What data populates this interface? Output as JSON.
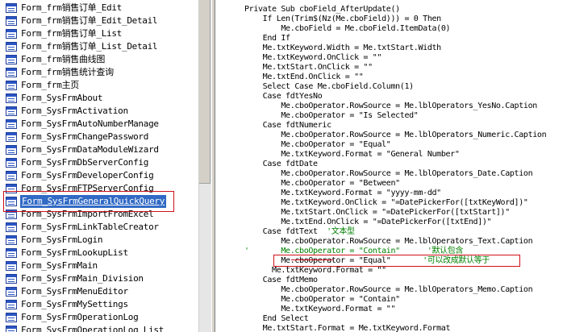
{
  "object_list": {
    "selected_index": 15,
    "items": [
      "Form_frm销售订单_Edit",
      "Form_frm销售订单_Edit_Detail",
      "Form_frm销售订单_List",
      "Form_frm销售订单_List_Detail",
      "Form_frm销售曲线图",
      "Form_frm销售统计查询",
      "Form_frm主页",
      "Form_SysFrmAbout",
      "Form_SysFrmActivation",
      "Form_SysFrmAutoNumberManage",
      "Form_SysFrmChangePassword",
      "Form_SysFrmDataModuleWizard",
      "Form_SysFrmDbServerConfig",
      "Form_SysFrmDeveloperConfig",
      "Form_SysFrmFTPServerConfig",
      "Form_SysFrmGeneralQuickQuery",
      "Form_SysFrmImportFromExcel",
      "Form_SysFrmLinkTableCreator",
      "Form_SysFrmLogin",
      "Form_SysFrmLookupList",
      "Form_SysFrmMain",
      "Form_SysFrmMain_Division",
      "Form_SysFrmMenuEditor",
      "Form_SysFrmMySettings",
      "Form_SysFrmOperationLog",
      "Form_SysFrmOperationLog_List"
    ]
  },
  "code": {
    "lines": [
      {
        "text": "Private Sub cboField_AfterUpdate()",
        "comment": ""
      },
      {
        "text": "    If Len(Trim$(Nz(Me.cboField))) = 0 Then",
        "comment": ""
      },
      {
        "text": "        Me.cboField = Me.cboField.ItemData(0)",
        "comment": ""
      },
      {
        "text": "    End If",
        "comment": ""
      },
      {
        "text": "    Me.txtKeyword.Width = Me.txtStart.Width",
        "comment": ""
      },
      {
        "text": "    Me.txtKeyword.OnClick = \"\"",
        "comment": ""
      },
      {
        "text": "    Me.txtStart.OnClick = \"\"",
        "comment": ""
      },
      {
        "text": "    Me.txtEnd.OnClick = \"\"",
        "comment": ""
      },
      {
        "text": "    Select Case Me.cboField.Column(1)",
        "comment": ""
      },
      {
        "text": "    Case fdtYesNo",
        "comment": ""
      },
      {
        "text": "        Me.cboOperator.RowSource = Me.lblOperators_YesNo.Caption",
        "comment": ""
      },
      {
        "text": "        Me.cboOperator = \"Is Selected\"",
        "comment": ""
      },
      {
        "text": "    Case fdtNumeric",
        "comment": ""
      },
      {
        "text": "        Me.cboOperator.RowSource = Me.lblOperators_Numeric.Caption",
        "comment": ""
      },
      {
        "text": "        Me.cboOperator = \"Equal\"",
        "comment": ""
      },
      {
        "text": "        Me.txtKeyword.Format = \"General Number\"",
        "comment": ""
      },
      {
        "text": "    Case fdtDate",
        "comment": ""
      },
      {
        "text": "        Me.cboOperator.RowSource = Me.lblOperators_Date.Caption",
        "comment": ""
      },
      {
        "text": "        Me.cboOperator = \"Between\"",
        "comment": ""
      },
      {
        "text": "        Me.txtKeyword.Format = \"yyyy-mm-dd\"",
        "comment": ""
      },
      {
        "text": "        Me.txtKeyword.OnClick = \"=DatePickerFor([txtKeyWord])\"",
        "comment": ""
      },
      {
        "text": "        Me.txtStart.OnClick = \"=DatePickerFor([txtStart])\"",
        "comment": ""
      },
      {
        "text": "        Me.txtEnd.OnClick = \"=DatePickerFor([txtEnd])\"",
        "comment": ""
      },
      {
        "text": "    Case fdtText  ",
        "comment": "'文本型"
      },
      {
        "text": "        Me.cboOperator.RowSource = Me.lblOperators_Text.Caption",
        "comment": ""
      },
      {
        "text": "",
        "comment": "'       Me.cboOperator = \"Contain\"      '默认包含"
      },
      {
        "text": "        Me.cboOperator = \"Equal\"       ",
        "comment": "'可以改成默认等于"
      },
      {
        "text": "      Me.txtKeyword.Format = \"\"",
        "comment": ""
      },
      {
        "text": "    Case fdtMemo",
        "comment": ""
      },
      {
        "text": "        Me.cboOperator.RowSource = Me.lblOperators_Memo.Caption",
        "comment": ""
      },
      {
        "text": "        Me.cboOperator = \"Contain\"",
        "comment": ""
      },
      {
        "text": "        Me.txtKeyword.Format = \"\"",
        "comment": ""
      },
      {
        "text": "    End Select",
        "comment": ""
      },
      {
        "text": "    Me.txtStart.Format = Me.txtKeyword.Format",
        "comment": ""
      }
    ]
  },
  "colors": {
    "keyword_text": "#000000",
    "comment_text": "#008000",
    "selection_bg": "#316ac5",
    "annotation_red": "#d0101a"
  }
}
